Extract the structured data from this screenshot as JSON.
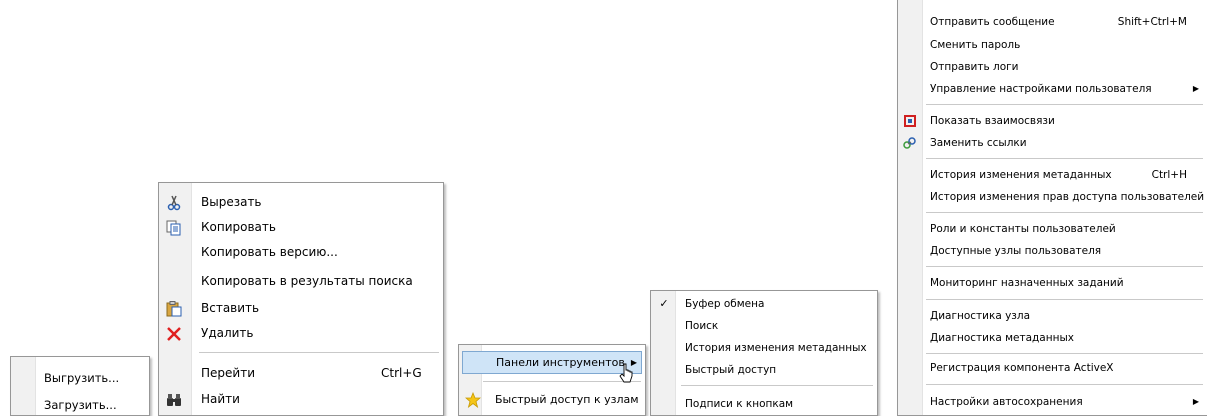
{
  "menu_a": {
    "items": [
      "Выгрузить...",
      "Загрузить..."
    ]
  },
  "menu_b": {
    "cut": "Вырезать",
    "copy": "Копировать",
    "copy_version": "Копировать версию...",
    "copy_to_results": "Копировать в результаты поиска",
    "paste": "Вставить",
    "delete": "Удалить",
    "goto": "Перейти",
    "goto_shortcut": "Ctrl+G",
    "find": "Найти"
  },
  "menu_c": {
    "toolbars": "Панели инструментов",
    "quick_access": "Быстрый доступ к узлам"
  },
  "menu_d": {
    "clipboard": "Буфер обмена",
    "search": "Поиск",
    "metadata_history": "История изменения метаданных",
    "quick_access": "Быстрый доступ",
    "button_captions": "Подписи к кнопкам"
  },
  "menu_e": {
    "send_message": "Отправить сообщение",
    "send_message_shortcut": "Shift+Ctrl+M",
    "change_password": "Сменить пароль",
    "send_logs": "Отправить логи",
    "user_settings": "Управление настройками пользователя",
    "show_relations": "Показать взаимосвязи",
    "replace_links": "Заменить ссылки",
    "metadata_history": "История изменения метаданных",
    "metadata_history_shortcut": "Ctrl+H",
    "rights_history": "История изменения прав доступа пользователей",
    "roles_constants": "Роли и константы пользователей",
    "available_nodes": "Доступные узлы пользователя",
    "tasks_monitoring": "Мониторинг назначенных заданий",
    "node_diagnostics": "Диагностика узла",
    "metadata_diagnostics": "Диагностика метаданных",
    "activex_registration": "Регистрация компонента ActiveX",
    "autosave_settings": "Настройки автосохранения"
  },
  "colors": {
    "highlight": "#cfe4f7",
    "gutter": "#f1f1f1",
    "separator": "#c9c9c9"
  },
  "icons": {
    "cut": "scissors-icon",
    "copy": "copy-icon",
    "paste": "paste-icon",
    "delete": "red-x-icon",
    "find": "binoculars-icon",
    "quick_access": "star-icon",
    "check": "checkmark-icon",
    "relations": "relations-icon",
    "replace_links": "links-icon",
    "submenu": "arrow-right-icon",
    "cursor": "mouse-pointer-icon"
  }
}
